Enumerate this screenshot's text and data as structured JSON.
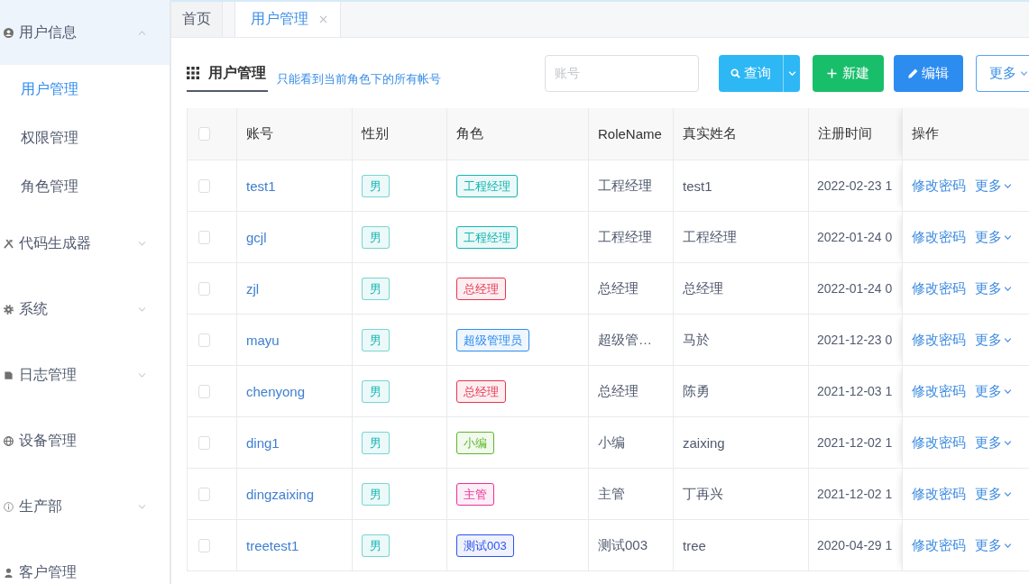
{
  "sidebar": {
    "items": [
      {
        "label": "用户信息",
        "kind": "group",
        "expanded": true,
        "selected": false,
        "children": [
          {
            "label": "用户管理",
            "selected": true
          },
          {
            "label": "权限管理",
            "selected": false
          },
          {
            "label": "角色管理",
            "selected": false
          }
        ]
      },
      {
        "label": "代码生成器",
        "kind": "group",
        "expanded": false,
        "selected": false
      },
      {
        "label": "系统",
        "kind": "group",
        "expanded": false,
        "selected": false
      },
      {
        "label": "日志管理",
        "kind": "group",
        "expanded": false,
        "selected": false
      },
      {
        "label": "设备管理",
        "kind": "link",
        "selected": false
      },
      {
        "label": "生产部",
        "kind": "group",
        "expanded": false,
        "selected": false
      },
      {
        "label": "客户管理",
        "kind": "link",
        "selected": false
      }
    ]
  },
  "tabs": [
    {
      "label": "首页",
      "selected": false,
      "closable": false
    },
    {
      "label": "用户管理",
      "selected": true,
      "closable": true
    }
  ],
  "toolbar": {
    "title": "用户管理",
    "hint": "只能看到当前角色下的所有帐号",
    "search": {
      "placeholder": "账号"
    },
    "buttons": [
      {
        "label": "查询",
        "kind": "search"
      },
      {
        "label": "新建",
        "kind": "create"
      },
      {
        "label": "编辑",
        "kind": "edit"
      },
      {
        "label": "更多",
        "kind": "more"
      }
    ]
  },
  "table": {
    "select_all": {
      "checked": false
    },
    "columns": [
      "账号",
      "性别",
      "角色",
      "RoleName",
      "真实姓名",
      "注册时间",
      "操作"
    ],
    "rows": [
      {
        "selected": false,
        "account": "test1",
        "gender": "男",
        "role": {
          "label": "工程经理",
          "color": "#13b5b1"
        },
        "role_name": "工程经理",
        "real_name": "test1",
        "registered": "2022-02-23 1",
        "actions": [
          {
            "label": "修改密码",
            "kind": "link"
          },
          {
            "label": "更多",
            "kind": "menu"
          }
        ]
      },
      {
        "selected": false,
        "account": "gcjl",
        "gender": "男",
        "role": {
          "label": "工程经理",
          "color": "#13b5b1"
        },
        "role_name": "工程经理",
        "real_name": "工程经理",
        "registered": "2022-01-24 0",
        "actions": [
          {
            "label": "修改密码",
            "kind": "link"
          },
          {
            "label": "更多",
            "kind": "menu"
          }
        ]
      },
      {
        "selected": false,
        "account": "zjl",
        "gender": "男",
        "role": {
          "label": "总经理",
          "color": "#e8344e"
        },
        "role_name": "总经理",
        "real_name": "总经理",
        "registered": "2022-01-24 0",
        "actions": [
          {
            "label": "修改密码",
            "kind": "link"
          },
          {
            "label": "更多",
            "kind": "menu"
          }
        ]
      },
      {
        "selected": false,
        "account": "mayu",
        "gender": "男",
        "role": {
          "label": "超级管理员",
          "color": "#2d8cf0"
        },
        "role_name": "超级管…",
        "real_name": "马於",
        "registered": "2021-12-23 0",
        "actions": [
          {
            "label": "修改密码",
            "kind": "link"
          },
          {
            "label": "更多",
            "kind": "menu"
          }
        ]
      },
      {
        "selected": false,
        "account": "chenyong",
        "gender": "男",
        "role": {
          "label": "总经理",
          "color": "#e8344e"
        },
        "role_name": "总经理",
        "real_name": "陈勇",
        "registered": "2021-12-03 1",
        "actions": [
          {
            "label": "修改密码",
            "kind": "link"
          },
          {
            "label": "更多",
            "kind": "menu"
          }
        ]
      },
      {
        "selected": false,
        "account": "ding1",
        "gender": "男",
        "role": {
          "label": "小编",
          "color": "#5cb82a"
        },
        "role_name": "小编",
        "real_name": "zaixing",
        "registered": "2021-12-02 1",
        "actions": [
          {
            "label": "修改密码",
            "kind": "link"
          },
          {
            "label": "更多",
            "kind": "menu"
          }
        ]
      },
      {
        "selected": false,
        "account": "dingzaixing",
        "gender": "男",
        "role": {
          "label": "主管",
          "color": "#eb2f96"
        },
        "role_name": "主管",
        "real_name": "丁再兴",
        "registered": "2021-12-02 1",
        "actions": [
          {
            "label": "修改密码",
            "kind": "link"
          },
          {
            "label": "更多",
            "kind": "menu"
          }
        ]
      },
      {
        "selected": false,
        "account": "treetest1",
        "gender": "男",
        "role": {
          "label": "测试003",
          "color": "#2f54eb"
        },
        "role_name": "测试003",
        "real_name": "tree",
        "registered": "2020-04-29 1",
        "actions": [
          {
            "label": "修改密码",
            "kind": "link"
          },
          {
            "label": "更多",
            "kind": "menu"
          }
        ]
      }
    ]
  }
}
